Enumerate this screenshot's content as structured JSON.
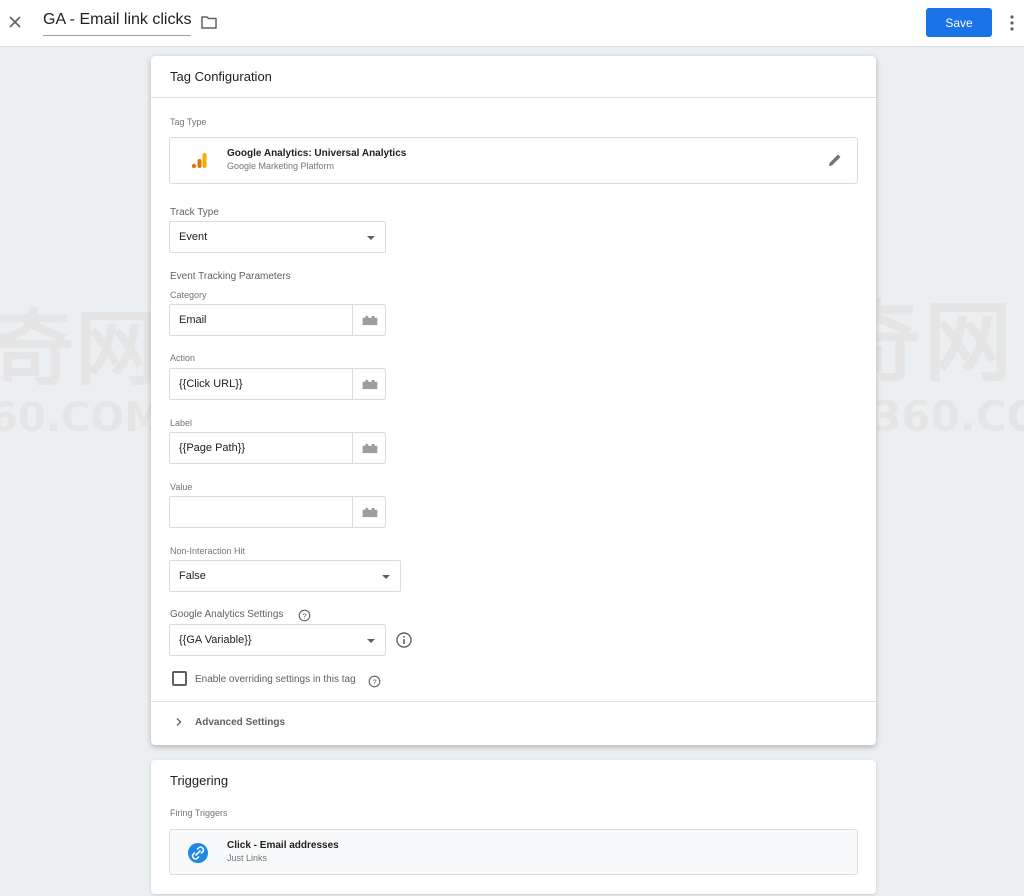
{
  "header": {
    "title": "GA - Email link clicks",
    "save_label": "Save"
  },
  "watermark": {
    "left_cn": "奇网",
    "left_en": "60.COM",
    "right_cn": "牛奇网",
    "right_en": "NIUQI360.CO"
  },
  "config": {
    "heading": "Tag Configuration",
    "tag_type_label": "Tag Type",
    "tag_type_title": "Google Analytics: Universal Analytics",
    "tag_type_subtitle": "Google Marketing Platform",
    "track_type_label": "Track Type",
    "track_type_value": "Event",
    "event_params_label": "Event Tracking Parameters",
    "category_label": "Category",
    "category_value": "Email",
    "action_label": "Action",
    "action_value": "{{Click URL}}",
    "label_label": "Label",
    "label_value": "{{Page Path}}",
    "value_label": "Value",
    "value_value": "",
    "non_interaction_label": "Non-Interaction Hit",
    "non_interaction_value": "False",
    "ga_settings_label": "Google Analytics Settings",
    "ga_settings_value": "{{GA Variable}}",
    "override_label": "Enable overriding settings in this tag",
    "override_checked": false,
    "advanced_label": "Advanced Settings"
  },
  "triggering": {
    "heading": "Triggering",
    "firing_label": "Firing Triggers",
    "trigger_title": "Click - Email addresses",
    "trigger_subtitle": "Just Links"
  },
  "colors": {
    "accent": "#1a73e8",
    "ga_orange": "#f9ab00",
    "ga_dark_orange": "#e37400",
    "trigger_blue": "#1e88e5"
  }
}
